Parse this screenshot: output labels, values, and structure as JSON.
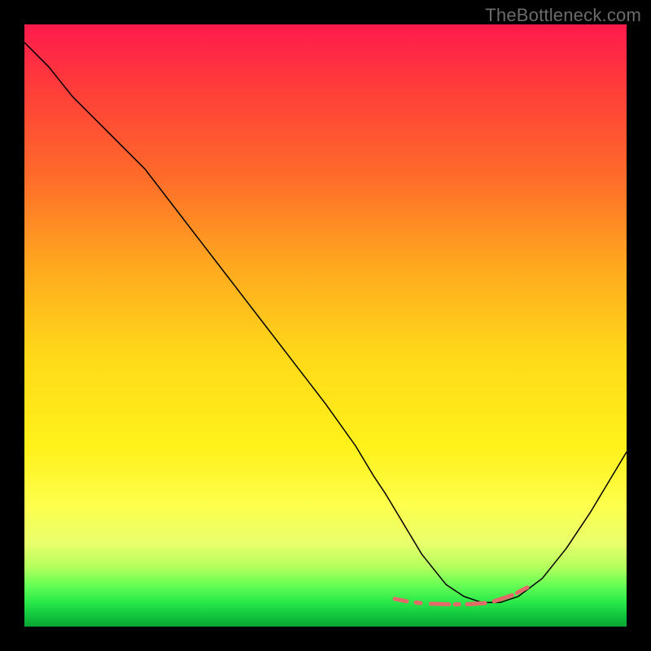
{
  "watermark": "TheBottleneck.com",
  "chart_data": {
    "type": "line",
    "title": "",
    "xlabel": "",
    "ylabel": "",
    "xlim": [
      0,
      100
    ],
    "ylim": [
      0,
      100
    ],
    "grid": false,
    "axes_visible": false,
    "legend": false,
    "series": [
      {
        "name": "bottleneck-curve",
        "stroke": "#000000",
        "stroke_width": 1.5,
        "x": [
          0,
          4,
          8,
          14,
          20,
          30,
          40,
          50,
          55,
          58,
          60,
          63,
          66,
          70,
          73,
          76,
          79,
          82,
          86,
          90,
          94,
          100
        ],
        "y": [
          97,
          93,
          88,
          82,
          76,
          63,
          50,
          37,
          30,
          25,
          22,
          17,
          12,
          7,
          5,
          4,
          4,
          5,
          8,
          13,
          19,
          29
        ]
      },
      {
        "name": "optimal-band-markers",
        "type": "segments",
        "stroke": "#e46a6a",
        "stroke_width": 5,
        "linecap": "round",
        "segments": [
          {
            "x": [
              61.5,
              63.5
            ],
            "y": [
              4.6,
              4.2
            ]
          },
          {
            "x": [
              65.0,
              65.8
            ],
            "y": [
              4.0,
              3.9
            ]
          },
          {
            "x": [
              67.5,
              70.5
            ],
            "y": [
              3.8,
              3.7
            ]
          },
          {
            "x": [
              71.5,
              72.2
            ],
            "y": [
              3.7,
              3.7
            ]
          },
          {
            "x": [
              73.5,
              76.5
            ],
            "y": [
              3.7,
              3.9
            ]
          },
          {
            "x": [
              78.0,
              81.0
            ],
            "y": [
              4.2,
              5.2
            ]
          },
          {
            "x": [
              81.8,
              83.5
            ],
            "y": [
              5.6,
              6.5
            ]
          }
        ]
      }
    ],
    "background": {
      "type": "vertical-gradient",
      "note": "red at top (high bottleneck) through yellow to green at bottom (low bottleneck)",
      "stops": [
        {
          "pos": 0.0,
          "color": "#ff1a4d"
        },
        {
          "pos": 0.25,
          "color": "#ff6a2a"
        },
        {
          "pos": 0.55,
          "color": "#ffd91a"
        },
        {
          "pos": 0.8,
          "color": "#fdff4d"
        },
        {
          "pos": 0.93,
          "color": "#6aff55"
        },
        {
          "pos": 1.0,
          "color": "#0aa534"
        }
      ]
    }
  }
}
